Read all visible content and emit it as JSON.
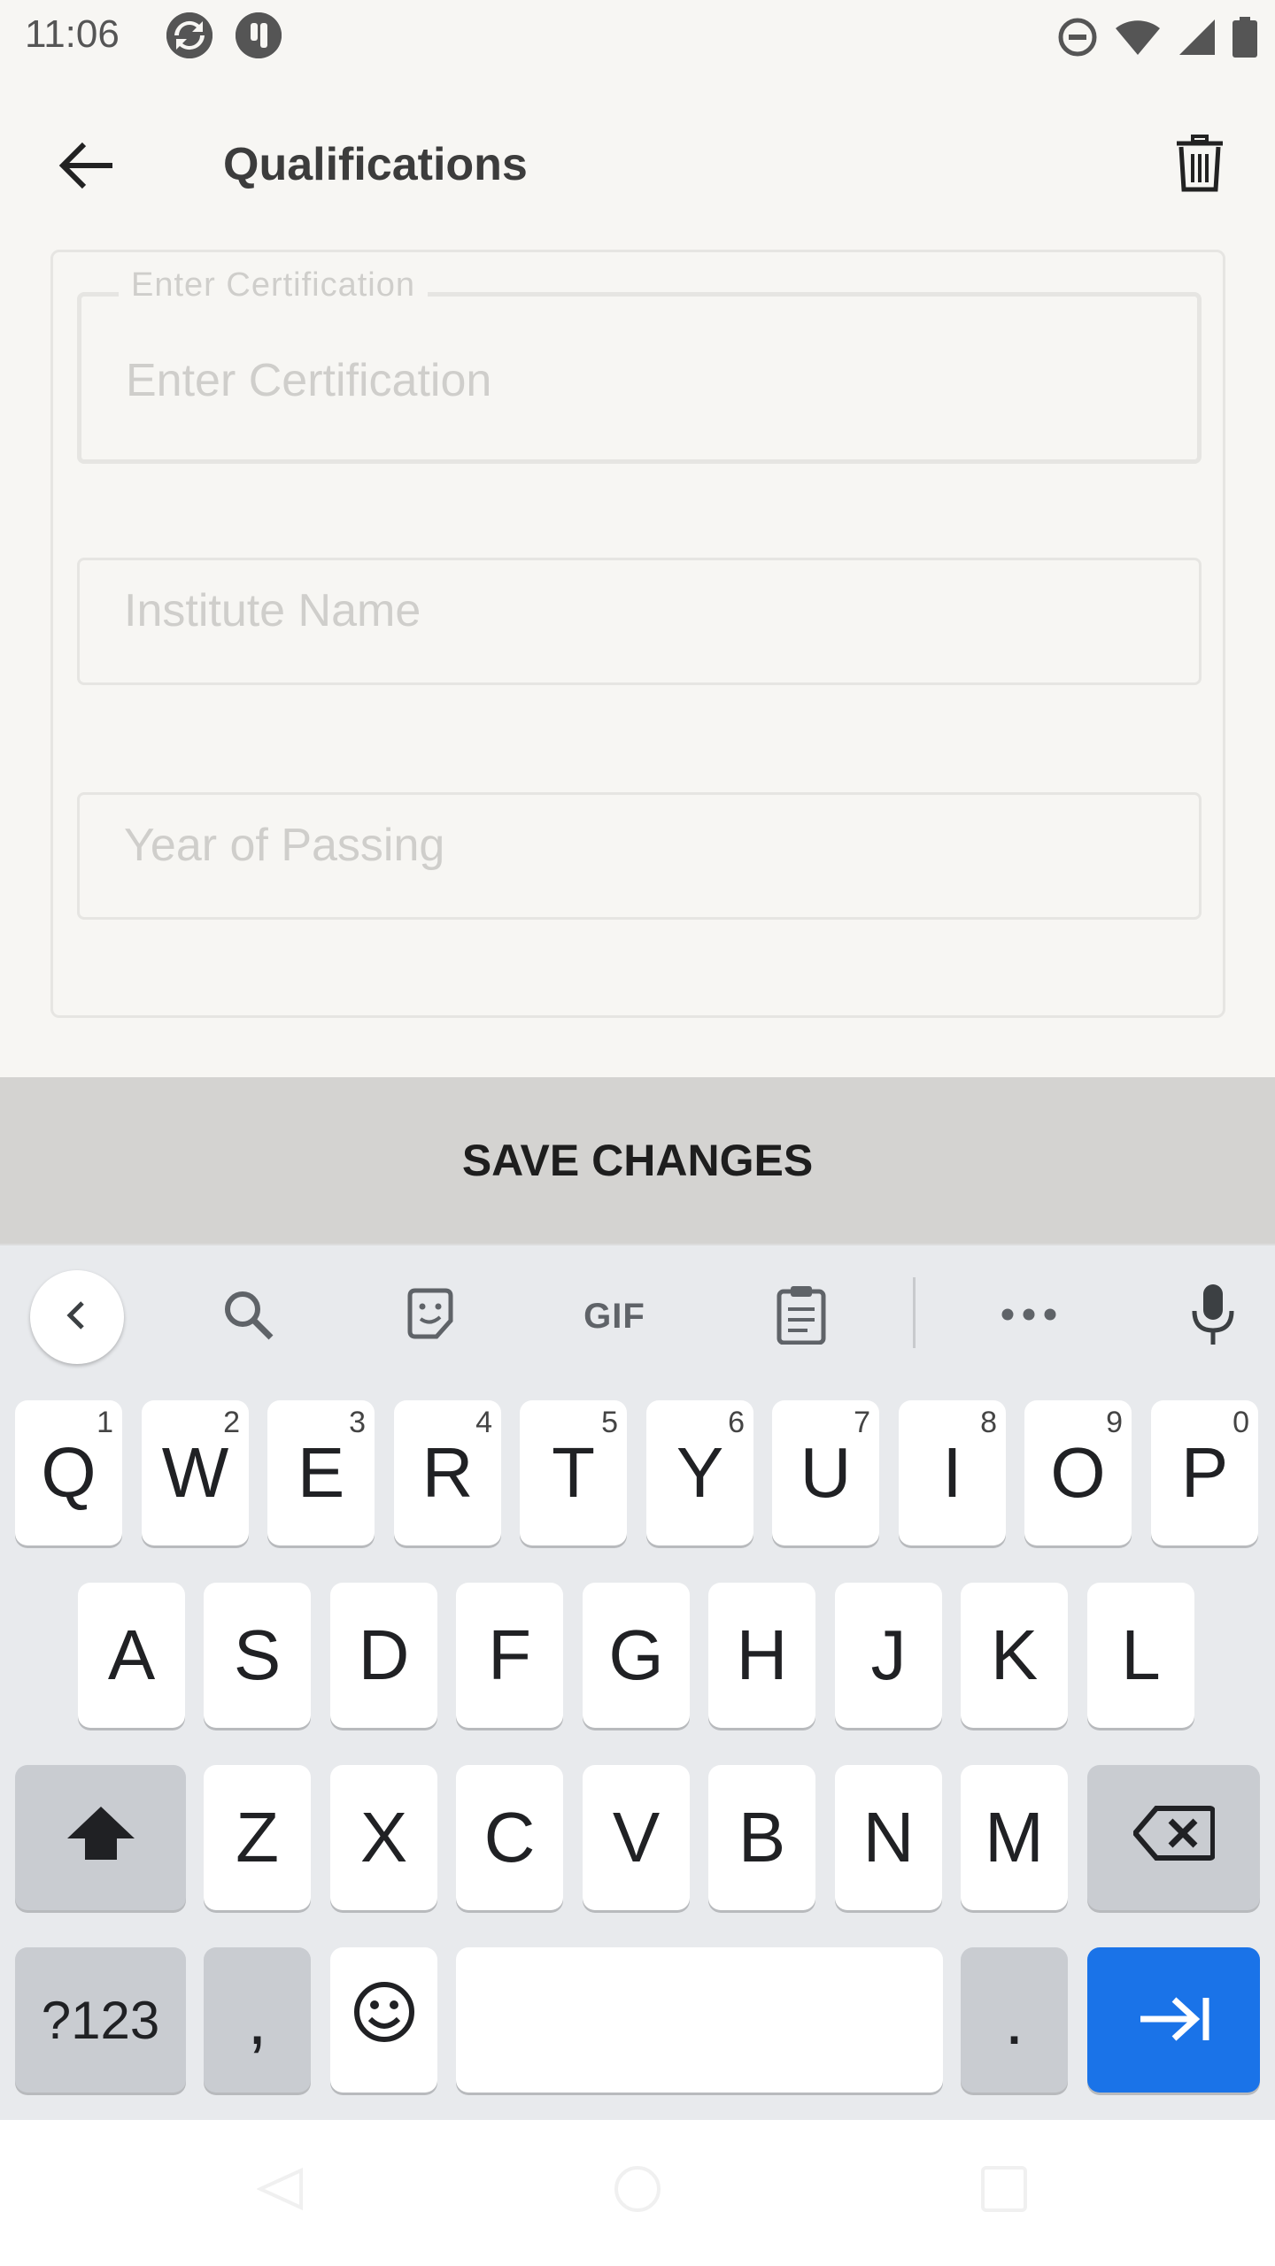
{
  "status_bar": {
    "time": "11:06",
    "icons": [
      "sync-app-icon",
      "notification-app-icon",
      "do-not-disturb-icon",
      "wifi-icon",
      "cell-signal-icon",
      "battery-icon"
    ]
  },
  "app_bar": {
    "title": "Qualifications",
    "back_icon": "arrow-left-icon",
    "delete_icon": "trash-icon"
  },
  "form": {
    "certification": {
      "label": "Enter Certification",
      "placeholder": "Enter Certification",
      "value": ""
    },
    "institute": {
      "placeholder": "Institute Name",
      "value": ""
    },
    "year": {
      "placeholder": "Year of Passing",
      "value": ""
    }
  },
  "save_button": {
    "label": "SAVE CHANGES"
  },
  "keyboard": {
    "toolbar": [
      "collapse-icon",
      "search-icon",
      "sticker-icon",
      "gif-icon",
      "clipboard-icon",
      "more-icon",
      "microphone-icon"
    ],
    "gif_label": "GIF",
    "row1": [
      {
        "key": "Q",
        "hint": "1"
      },
      {
        "key": "W",
        "hint": "2"
      },
      {
        "key": "E",
        "hint": "3"
      },
      {
        "key": "R",
        "hint": "4"
      },
      {
        "key": "T",
        "hint": "5"
      },
      {
        "key": "Y",
        "hint": "6"
      },
      {
        "key": "U",
        "hint": "7"
      },
      {
        "key": "I",
        "hint": "8"
      },
      {
        "key": "O",
        "hint": "9"
      },
      {
        "key": "P",
        "hint": "0"
      }
    ],
    "row2": [
      "A",
      "S",
      "D",
      "F",
      "G",
      "H",
      "J",
      "K",
      "L"
    ],
    "row3": [
      "Z",
      "X",
      "C",
      "V",
      "B",
      "N",
      "M"
    ],
    "symbols_label": "?123",
    "comma": ",",
    "period": "."
  },
  "colors": {
    "background": "#f7f6f3",
    "save_bar": "#d4d3d1",
    "keyboard_bg": "#e8eaed",
    "action_key": "#1a73e8"
  }
}
